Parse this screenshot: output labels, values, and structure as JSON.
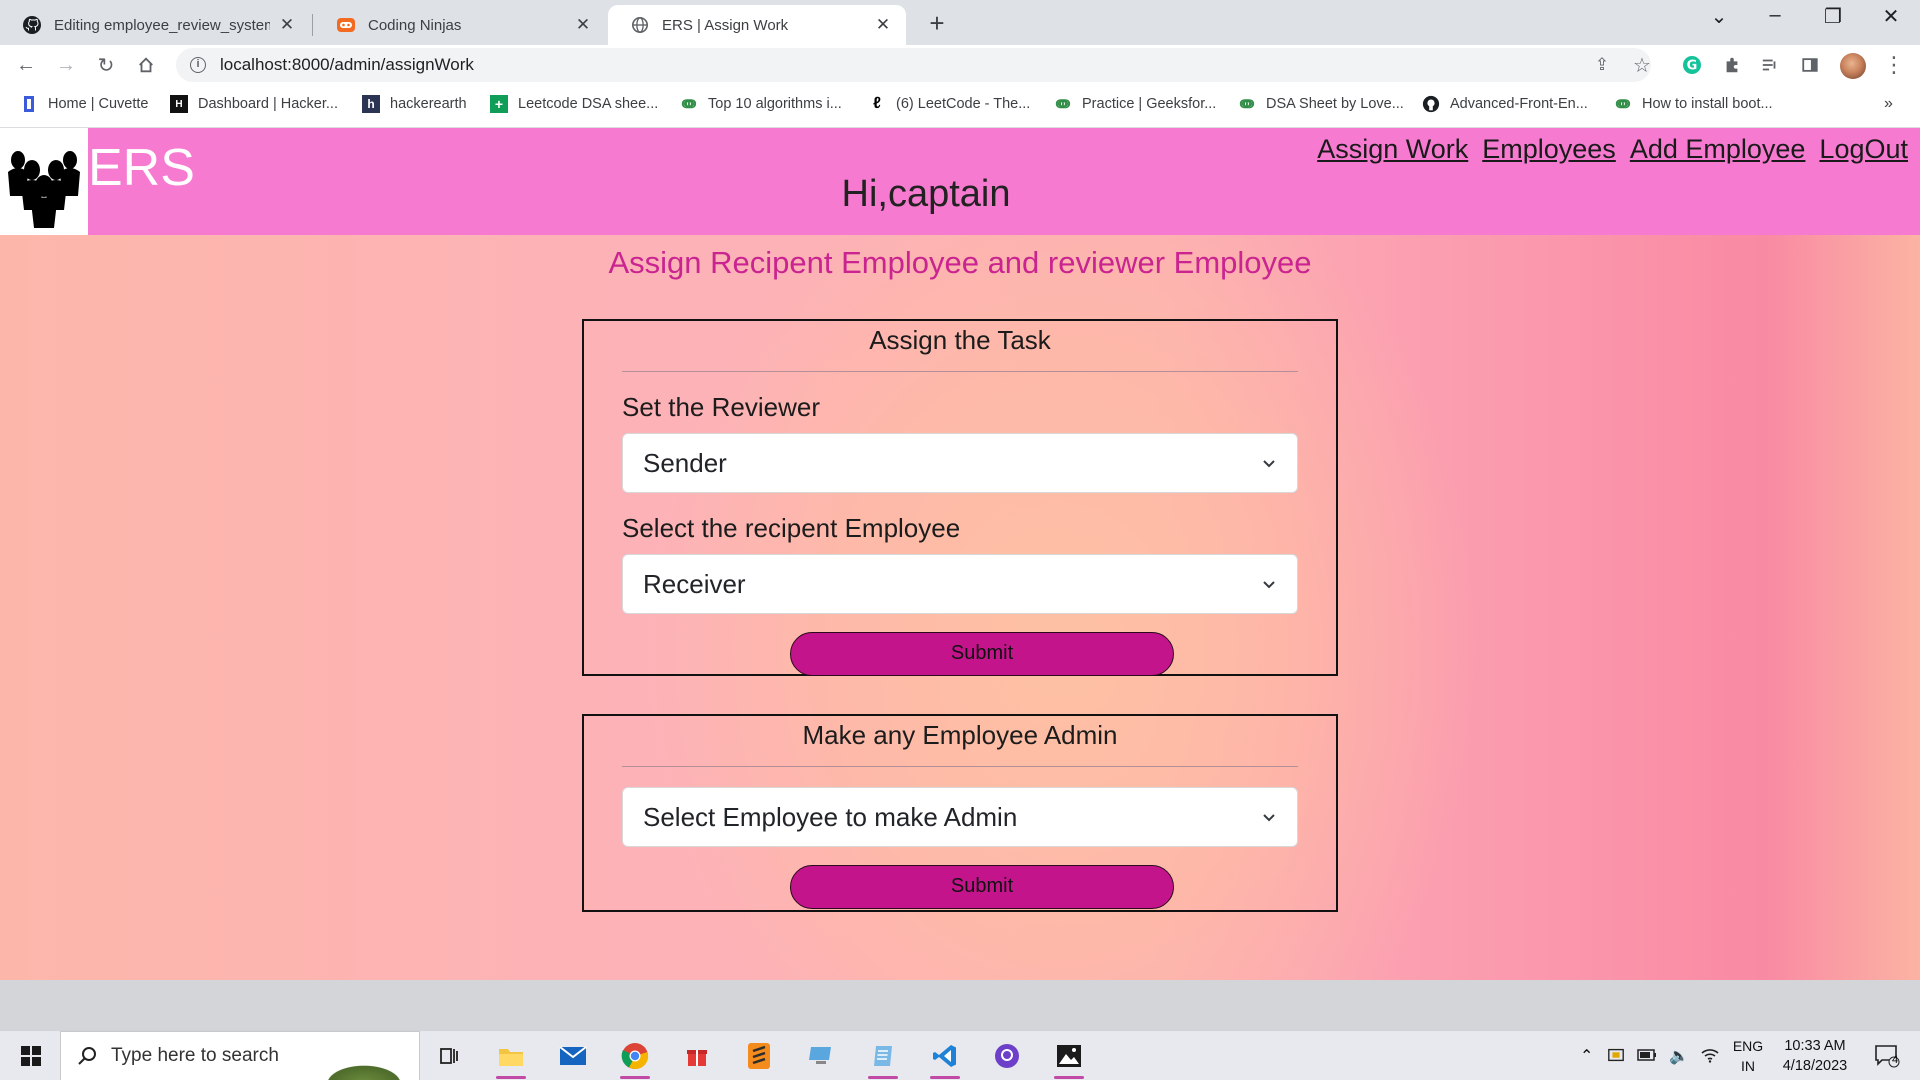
{
  "browser": {
    "tabs": [
      {
        "title": "Editing employee_review_system",
        "icon": "github-icon",
        "active": false
      },
      {
        "title": "Coding Ninjas",
        "icon": "coding-ninjas-icon",
        "active": false
      },
      {
        "title": "ERS | Assign Work",
        "icon": "globe-icon",
        "active": true
      }
    ],
    "url": "localhost:8000/admin/assignWork",
    "bookmarks": [
      {
        "label": "Home | Cuvette",
        "icon": "cuvette-icon"
      },
      {
        "label": "Dashboard | Hacker...",
        "icon": "hackerrank-icon"
      },
      {
        "label": "hackerearth",
        "icon": "hackerearth-icon"
      },
      {
        "label": "Leetcode DSA shee...",
        "icon": "sheets-icon"
      },
      {
        "label": "Top 10 algorithms i...",
        "icon": "gfg-icon"
      },
      {
        "label": "(6) LeetCode - The...",
        "icon": "leetcode-icon"
      },
      {
        "label": "Practice | Geeksfor...",
        "icon": "gfg-icon"
      },
      {
        "label": "DSA Sheet by Love...",
        "icon": "gfg-icon"
      },
      {
        "label": "Advanced-Front-En...",
        "icon": "github-icon"
      },
      {
        "label": "How to install boot...",
        "icon": "gfg-icon"
      }
    ],
    "more_bookmarks": "»"
  },
  "app": {
    "brand": "ERS",
    "greeting": "Hi,captain",
    "nav": [
      {
        "label": "Assign Work"
      },
      {
        "label": "Employees"
      },
      {
        "label": "Add Employee"
      },
      {
        "label": "LogOut"
      }
    ],
    "heading": "Assign Recipent Employee and reviewer Employee",
    "assign_card": {
      "title": "Assign the Task",
      "reviewer_label": "Set the Reviewer",
      "reviewer_value": "Sender",
      "recipient_label": "Select the recipent Employee",
      "recipient_value": "Receiver",
      "submit_label": "Submit"
    },
    "admin_card": {
      "title": "Make any Employee Admin",
      "select_value": "Select Employee to make Admin",
      "submit_label": "Submit"
    },
    "colors": {
      "navbar": "#f77ad1",
      "heading": "#c9248f",
      "button": "#c4148b"
    }
  },
  "taskbar": {
    "search_placeholder": "Type here to search",
    "lang_line1": "ENG",
    "lang_line2": "IN",
    "time": "10:33 AM",
    "date": "4/18/2023",
    "notifications": "4"
  }
}
